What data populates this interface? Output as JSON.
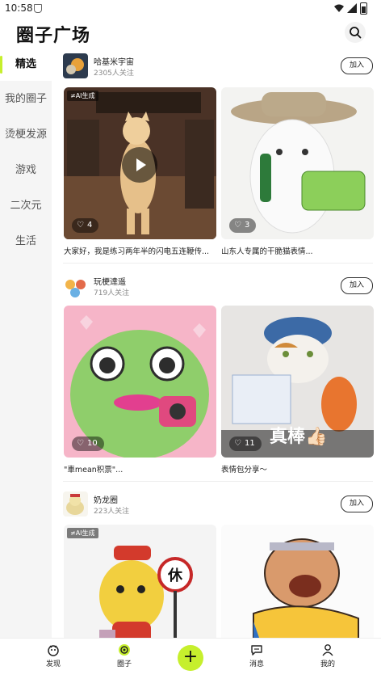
{
  "status_bar": {
    "time": "10:58"
  },
  "header": {
    "title": "圈子广场"
  },
  "sidebar": {
    "items": [
      {
        "label": "精选",
        "active": true
      },
      {
        "label": "我的圈子"
      },
      {
        "label": "烫梗发源"
      },
      {
        "label": "游戏"
      },
      {
        "label": "二次元"
      },
      {
        "label": "生活"
      }
    ]
  },
  "feed": {
    "join_label": "加入",
    "ai_badge": "≠AI生成",
    "circles": [
      {
        "name": "哈基米宇宙",
        "followers": "2305人关注",
        "cards": [
          {
            "likes": "4",
            "caption": "大家好，我是练习两年半的闪电五连鞭传..."
          },
          {
            "likes": "3",
            "caption": "山东人专属的干脆猫表情..."
          }
        ]
      },
      {
        "name": "玩梗達遥",
        "followers": "719人关注",
        "cards": [
          {
            "likes": "10",
            "caption": "\"車mean积票\"..."
          },
          {
            "likes": "11",
            "caption": "表情包分享～",
            "overlay": "真棒👍🏻"
          }
        ]
      },
      {
        "name": "奶龙圈",
        "followers": "223人关注",
        "cards": [
          {
            "sign_text": "休"
          },
          {}
        ]
      }
    ]
  },
  "bottom_nav": {
    "items": [
      {
        "label": "发现",
        "icon": "discover-icon"
      },
      {
        "label": "圈子",
        "icon": "circle-icon",
        "active": true
      },
      {
        "label": "消息",
        "icon": "message-icon"
      },
      {
        "label": "我的",
        "icon": "profile-icon"
      }
    ],
    "add_label": "+",
    "accent": "#c6ef2d"
  }
}
